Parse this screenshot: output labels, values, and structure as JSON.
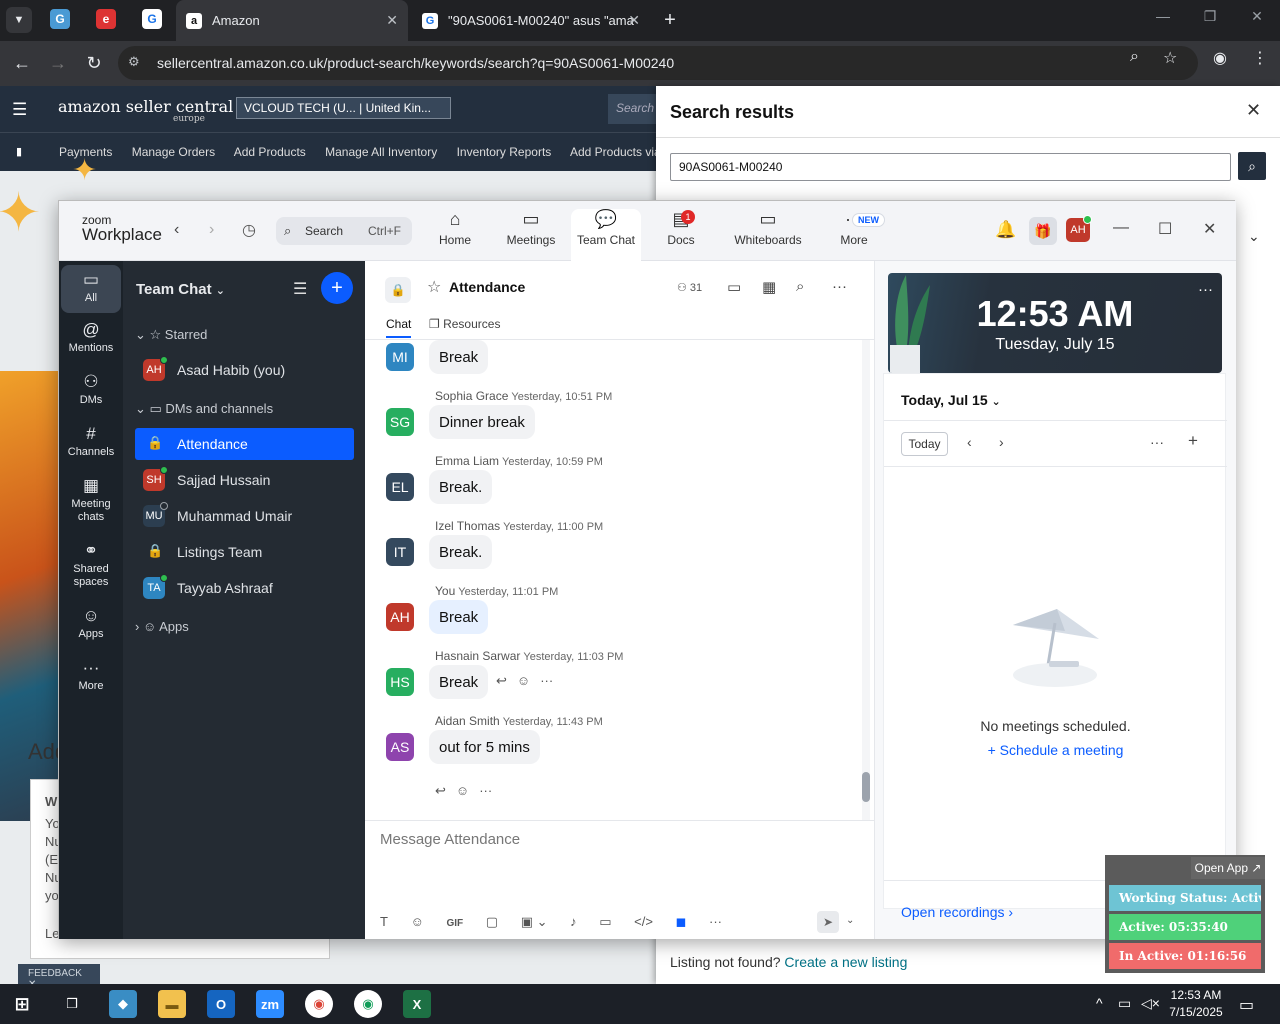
{
  "browser": {
    "tabs": [
      {
        "title": "Amazon",
        "active": true
      },
      {
        "title": "\"90AS0061-M00240\" asus \"ama",
        "active": false
      }
    ],
    "url": "sellercentral.amazon.co.uk/product-search/keywords/search?q=90AS0061-M00240"
  },
  "amazon": {
    "logo": "amazon seller central",
    "logo_sub": "europe",
    "account": "VCLOUD TECH (U...  |  United Kin...",
    "search_placeholder": "Search",
    "nav": [
      "Payments",
      "Manage Orders",
      "Add Products",
      "Manage All Inventory",
      "Inventory Reports",
      "Add Products via Upl"
    ],
    "heading_fragment": "Add",
    "card_lines": [
      "W",
      "Yo",
      "Nu",
      "(E",
      "Nu",
      "yo",
      "Le"
    ],
    "feedback": "FEEDBACK ✕"
  },
  "search_results": {
    "title": "Search results",
    "query": "90AS0061-M00240",
    "not_found": "Listing not found?",
    "create_link": "Create a new listing"
  },
  "zoom": {
    "logo_top": "zoom",
    "logo_bottom": "Workplace",
    "search": {
      "label": "Search",
      "shortcut": "Ctrl+F"
    },
    "tabs": [
      {
        "label": "Home",
        "icon": "home-icon"
      },
      {
        "label": "Meetings",
        "icon": "video-icon"
      },
      {
        "label": "Team Chat",
        "icon": "chat-icon"
      },
      {
        "label": "Docs",
        "icon": "docs-icon"
      },
      {
        "label": "Whiteboards",
        "icon": "whiteboard-icon"
      },
      {
        "label": "More",
        "icon": "more-icon"
      }
    ],
    "docs_badge": "1",
    "new_badge": "NEW",
    "user_initials": "AH",
    "rail": [
      "All",
      "Mentions",
      "DMs",
      "Channels",
      "Meeting chats",
      "Shared spaces",
      "Apps",
      "More"
    ],
    "list": {
      "title": "Team Chat",
      "starred": "Starred",
      "self": {
        "initials": "AH",
        "name": "Asad Habib (you)",
        "color": "#c0392b"
      },
      "dms_section": "DMs and channels",
      "items": [
        {
          "name": "Attendance",
          "type": "channel"
        },
        {
          "initials": "SH",
          "name": "Sajjad Hussain",
          "color": "#c0392b"
        },
        {
          "initials": "MU",
          "name": "Muhammad Umair",
          "color": "#2c3e50"
        },
        {
          "name": "Listings Team",
          "type": "channel"
        },
        {
          "initials": "TA",
          "name": "Tayyab Ashraaf",
          "color": "#2e86c1"
        }
      ],
      "apps": "Apps"
    },
    "chat": {
      "channel": "Attendance",
      "members": "31",
      "tabs": [
        "Chat",
        "Resources"
      ],
      "messages": [
        {
          "initials": "MI",
          "color": "#2e86c1",
          "name": "",
          "time": "",
          "text": "Break",
          "mine": false
        },
        {
          "initials": "SG",
          "color": "#27ae60",
          "name": "Sophia Grace",
          "time": "Yesterday, 10:51 PM",
          "text": "Dinner break",
          "mine": false
        },
        {
          "initials": "EL",
          "color": "#34495e",
          "name": "Emma Liam",
          "time": "Yesterday, 10:59 PM",
          "text": "Break.",
          "mine": false
        },
        {
          "initials": "IT",
          "color": "#34495e",
          "name": "Izel Thomas",
          "time": "Yesterday, 11:00 PM",
          "text": "Break.",
          "mine": false
        },
        {
          "initials": "AH",
          "color": "#c0392b",
          "name": "You",
          "time": "Yesterday, 11:01 PM",
          "text": "Break",
          "mine": true
        },
        {
          "initials": "HS",
          "color": "#27ae60",
          "name": "Hasnain Sarwar",
          "time": "Yesterday, 11:03 PM",
          "text": "Break",
          "mine": false
        },
        {
          "initials": "AS",
          "color": "#8e44ad",
          "name": "Aidan Smith",
          "time": "Yesterday, 11:43 PM",
          "text": "out for 5 mins",
          "mine": false
        }
      ],
      "compose_placeholder": "Message Attendance",
      "gif": "GIF"
    },
    "calendar": {
      "time": "12:53 AM",
      "date": "Tuesday, July 15",
      "day_label": "Today, Jul 15",
      "today_btn": "Today",
      "no_meetings": "No meetings scheduled.",
      "schedule": "Schedule a meeting",
      "open_recordings": "Open recordings"
    }
  },
  "status_widget": {
    "open_app": "Open App ↗",
    "working": "Working Status: Active",
    "active": "Active: 05:35:40",
    "inactive": "In Active: 01:16:56",
    "colors": {
      "working": "#6ec4d4",
      "active": "#4fd17a",
      "inactive": "#f06b6b"
    }
  },
  "taskbar": {
    "time": "12:53 AM",
    "date": "7/15/2025"
  }
}
